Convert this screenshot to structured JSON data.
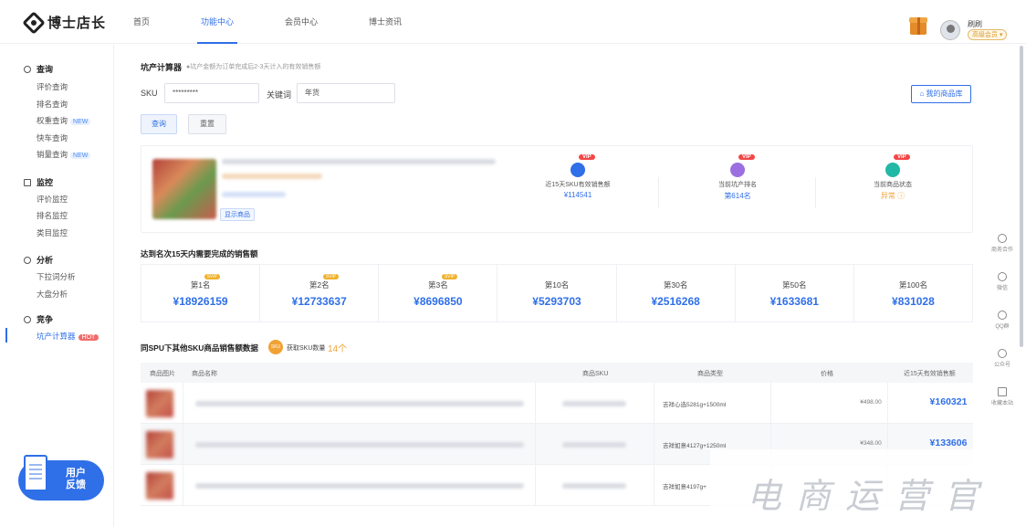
{
  "brand": {
    "name": "博士店长"
  },
  "nav": [
    {
      "label": "首页"
    },
    {
      "label": "功能中心"
    },
    {
      "label": "会员中心"
    },
    {
      "label": "博士资讯"
    }
  ],
  "user": {
    "name": "刷刷",
    "badge": "高级会员 ▾"
  },
  "sidebar": {
    "groups": [
      {
        "label": "查询",
        "items": [
          "评价查询",
          "排名查询",
          "权重查询",
          "快车查询",
          "销量查询"
        ]
      },
      {
        "label": "监控",
        "items": [
          "评价监控",
          "排名监控",
          "类目监控"
        ]
      },
      {
        "label": "分析",
        "items": [
          "下拉词分析",
          "大盘分析"
        ]
      },
      {
        "label": "竞争",
        "items": [
          "坑产计算器"
        ]
      }
    ],
    "tag_new": "NEW",
    "tag_hot": "HOT"
  },
  "feedback": {
    "line1": "用户",
    "line2": "反馈"
  },
  "tool": {
    "title": "坑产计算器",
    "tip": "●坑产金额为订单完成后2-3天计入的有效销售额",
    "sku_label": "SKU",
    "sku_value": "*********",
    "keyword_label": "关键词",
    "keyword_value": "年货",
    "query_button": "查询",
    "reset_button": "重置",
    "library_button": "我的商品库"
  },
  "product": {
    "shop_link": "显示商品",
    "vip": "VIP",
    "stats": [
      {
        "label": "近15天SKU有效销售额",
        "value": "¥114541"
      },
      {
        "label": "当前坑产排名",
        "value": "第614名"
      },
      {
        "label": "当前商品状态",
        "value": "异常 ⓘ"
      }
    ]
  },
  "ranking": {
    "title": "达到名次15天内需要完成的销售额",
    "badge": "SVIP",
    "cells": [
      {
        "name": "第1名",
        "value": "¥18926159"
      },
      {
        "name": "第2名",
        "value": "¥12733637"
      },
      {
        "name": "第3名",
        "value": "¥8696850"
      },
      {
        "name": "第10名",
        "value": "¥5293703"
      },
      {
        "name": "第30名",
        "value": "¥2516268"
      },
      {
        "name": "第50名",
        "value": "¥1633681"
      },
      {
        "name": "第100名",
        "value": "¥831028"
      }
    ]
  },
  "spu": {
    "title": "同SPU下其他SKU商品销售额数据",
    "badge": "SKU",
    "count_label": "获取SKU数量",
    "count_value": "14个"
  },
  "table": {
    "headers": [
      "商品图片",
      "商品名称",
      "商品SKU",
      "商品类型",
      "价格",
      "近15天有效销售额"
    ],
    "rows": [
      {
        "spec": "吉祥心选5281g+1500ml",
        "price": "¥498.00",
        "sales": "¥160321"
      },
      {
        "spec": "吉祥如意4127g+1250ml",
        "price": "¥348.00",
        "sales": "¥133606"
      },
      {
        "spec": "吉祥如意4197g+",
        "price": "",
        "sales": ""
      }
    ]
  },
  "float_bar": [
    "商务合作",
    "微信",
    "QQ群",
    "公众号",
    "收藏本站"
  ],
  "watermark": "电商运营官",
  "colors": {
    "accent": "#2f6fe8",
    "vip": "#f44646",
    "svip": "#f0b12c",
    "hot": "#f26b6b"
  }
}
